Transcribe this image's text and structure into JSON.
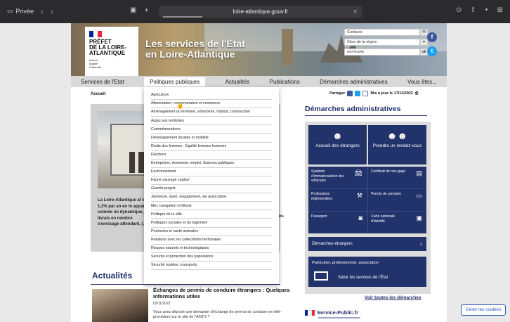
{
  "browser": {
    "mode_label": "Privée",
    "url": "loire-atlantique.gouv.fr"
  },
  "header": {
    "logo_lines": [
      "PRÉFET",
      "DE LA LOIRE-",
      "ATLANTIQUE"
    ],
    "motto": [
      "Liberté",
      "Égalité",
      "Fraternité"
    ],
    "banner_title": [
      "Les services de l'État",
      "en Loire-Atlantique"
    ],
    "contacts_label": "Contacts",
    "sites_label": "Sites de la région",
    "search_placeholder": "recherche",
    "search_button": "ok"
  },
  "mainnav": [
    "Services de l'Etat",
    "Politiques publiques",
    "Actualités",
    "Publications",
    "Démarches administratives",
    "Vous êtes..."
  ],
  "breadcrumb": "Accueil",
  "share": {
    "label": "Partager",
    "updated": "Mis à jour le 17/11/2022"
  },
  "dropdown": [
    "Agriculture",
    "Alimentation, consommation et commerce",
    "Aménagement du territoire, urbanisme, habitat, construction",
    "Appui aux territoires",
    "Commémorations",
    "Développement durable et mobilité",
    "Droits des femmes - Égalité femmes hommes",
    "Élections",
    "Entreprises, économie, emploi, finances publiques",
    "Environnement",
    "Faune sauvage captive",
    "Grands projets",
    "Jeunesse, sport, engagement, vie associative",
    "Mer, navigation et littoral",
    "Politique de la ville",
    "Politiques sociales et du logement",
    "Protection et santé animales",
    "Relations avec les collectivités territoriales",
    "Risques naturels et technologiques",
    "Sécurité et protection des populations",
    "Sécurité routière, transports"
  ],
  "featured": {
    "snippet": "La Loire-Atlantique af de 1,2% par an en m apparaît comme un dynamique, la livrais en nombre s'envisage attendant, (...)",
    "partial_right": "se",
    "partial_right2": "es"
  },
  "actualites": {
    "title": "Actualités",
    "news_title": "Échanges de permis de conduire étrangers : Quelques informations utiles",
    "news_date": "03/11/2022",
    "news_body": "Vous avez déposé une demande d'échange de permis de conduire en télé-procédure sur le site de l'ANTS ?"
  },
  "demarches": {
    "title": "Démarches administratives",
    "big": [
      {
        "label": "Accueil des étrangers",
        "icon": "person-globe-icon"
      },
      {
        "label": "Prendre un rendez-vous",
        "icon": "people-icon"
      }
    ],
    "cells": [
      {
        "label": "Système d'immatriculation des véhicules",
        "icon": "car-icon"
      },
      {
        "label": "Certificat de non-gage",
        "icon": "document-icon"
      },
      {
        "label": "Professions réglementées",
        "icon": "gavel-icon"
      },
      {
        "label": "Permis de conduire",
        "icon": "license-icon"
      },
      {
        "label": "Passeport",
        "icon": "passport-icon"
      },
      {
        "label": "Carte nationale d'identité",
        "icon": "id-card-icon"
      }
    ],
    "strip": "Démarches étrangers",
    "blue_text": "Particulier, professionnel, association",
    "blue_cta": "Saisir les services de l'État",
    "see_all": "Voir toutes les démarches"
  },
  "service_public": "Service-Public.fr",
  "cookies": "Gérer les cookies",
  "colors": {
    "navy": "#22326b",
    "cookie_blue": "#2a57b8",
    "flag_blue": "#002395",
    "flag_red": "#ed2939"
  }
}
